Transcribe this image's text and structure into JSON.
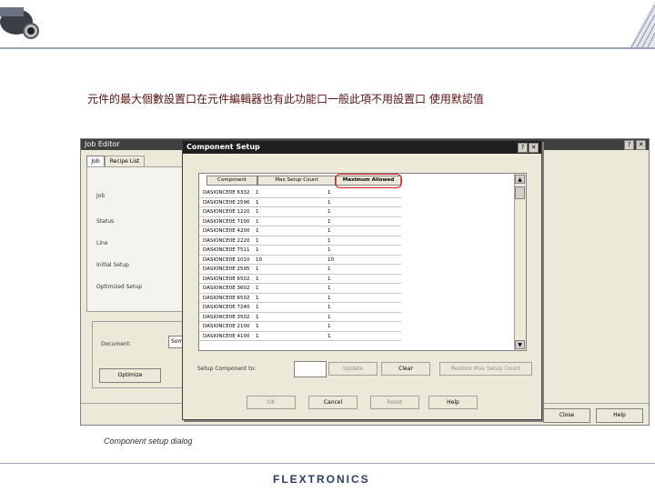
{
  "slide": {
    "caption_cn": "元件的最大個數設置口在元件編輯器也有此功能口一般此項不用設置口 使用默認值",
    "caption_en": "Component setup dialog",
    "logo": "FLEXTRONICS"
  },
  "job_editor": {
    "title": "Job Editor",
    "help_glyph": "?",
    "close_glyph": "✕",
    "tabs": [
      "Job",
      "Recipe List"
    ],
    "labels": [
      "Job",
      "Status",
      "Line",
      "Initial Setup",
      "Optimized Setup"
    ],
    "document_label": "Document:",
    "document_value": "Som",
    "optimize_button": "Optimize",
    "close_button": "Close",
    "help_button": "Help"
  },
  "dialog": {
    "title": "Component Setup",
    "help_glyph": "?",
    "close_glyph": "✕",
    "columns": [
      "Component",
      "Max Setup Count",
      "Maximum Allowed"
    ],
    "rows": [
      [
        "DASIONCE0E 6332",
        "1",
        "1"
      ],
      [
        "DASIONCE0E 2596",
        "1",
        "1"
      ],
      [
        "DASIONCE0E 1220",
        "1",
        "1"
      ],
      [
        "DASIONCE0E 7100",
        "1",
        "1"
      ],
      [
        "DASIONCE0E 4200",
        "1",
        "1"
      ],
      [
        "DASIONCE0E 2220",
        "1",
        "1"
      ],
      [
        "DASIONCE0E 7511",
        "1",
        "1"
      ],
      [
        "DASIONCE0E 1010",
        "10",
        "10"
      ],
      [
        "DASIONCE0E 2595",
        "1",
        "1"
      ],
      [
        "DASIONCE0E 6502",
        "1",
        "1"
      ],
      [
        "DASIONCE0E 3602",
        "1",
        "1"
      ],
      [
        "DASIONCE0E 6502",
        "1",
        "1"
      ],
      [
        "DASIONCE0E 7240",
        "1",
        "1"
      ],
      [
        "DASIONCE0E 3502",
        "1",
        "1"
      ],
      [
        "DASIONCE0E 2100",
        "1",
        "1"
      ],
      [
        "DASIONCE0E 4100",
        "1",
        "1"
      ]
    ],
    "scroll_up": "▲",
    "scroll_down": "▼",
    "number_label": "Setup Component to:",
    "buttons": {
      "update": "Update",
      "clear": "Clear",
      "restore": "Restore Max Setup Count",
      "ok": "OK",
      "cancel": "Cancel",
      "reset": "Reset",
      "help": "Help"
    }
  }
}
